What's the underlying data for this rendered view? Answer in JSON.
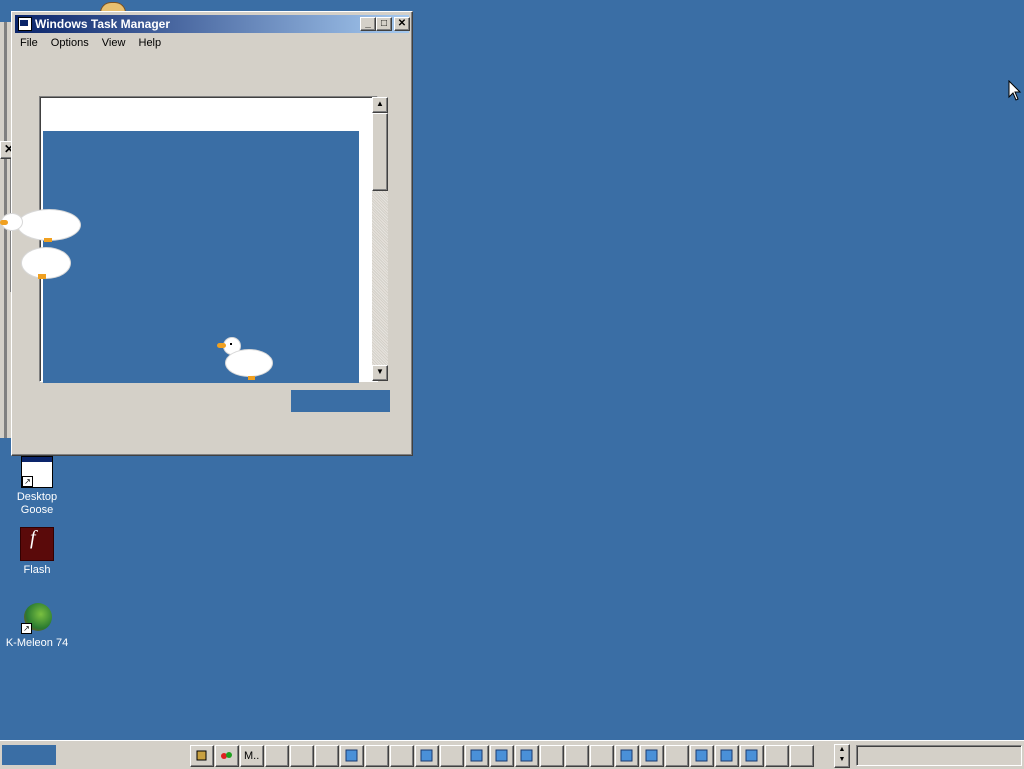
{
  "window": {
    "title": "Windows Task Manager",
    "buttons": {
      "minimize": "_",
      "maximize": "□",
      "close": "✕"
    },
    "menu": [
      "File",
      "Options",
      "View",
      "Help"
    ],
    "scroll_up": "▲",
    "scroll_down": "▼"
  },
  "background_window": {
    "close": "✕"
  },
  "desktop": {
    "icons": [
      {
        "label_line1": "Desktop",
        "label_line2": "Goose",
        "icon": "desktop-goose-icon"
      },
      {
        "label_line1": "Flash",
        "label_line2": "",
        "icon": "flash-icon"
      },
      {
        "label_line1": "K-Meleon 74",
        "label_line2": "",
        "icon": "k-meleon-icon"
      }
    ]
  },
  "taskbar": {
    "quick_label": "M..",
    "spin_up": "▲",
    "spin_down": "▼"
  },
  "colors": {
    "desktop": "#3a6ea5",
    "face": "#d4d0c8",
    "title_active": "#0a246a"
  }
}
